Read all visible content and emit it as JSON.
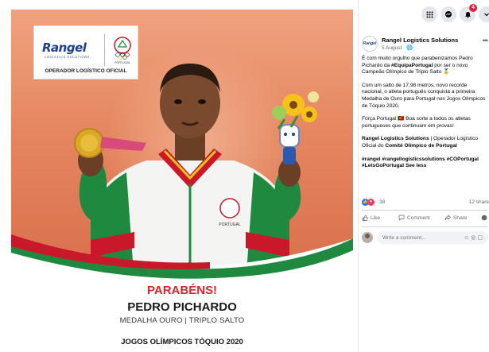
{
  "image": {
    "logo": {
      "brand": "Rangel",
      "brand_sub": "LOGISTICS SOLUTIONS",
      "partner": "PORTUGAL",
      "tagline": "OPERADOR LOGÍSTICO OFICIAL"
    },
    "caption": {
      "congrats": "PARABÉNS!",
      "athlete_name": "PEDRO PICHARDO",
      "medal": "MEDALHA OURO | TRIPLO SALTO",
      "games": "JOGOS OLÍMPICOS TÓQUIO 2020"
    }
  },
  "facebook": {
    "topbar": {
      "icons": [
        "menu-grid-icon",
        "messenger-icon",
        "notifications-icon",
        "account-dropdown-icon"
      ],
      "notification_count": "4"
    },
    "post": {
      "page_avatar_text": "Rangel",
      "page_name": "Rangel Logistics Solutions",
      "date": "5 August · ",
      "paragraph1_a": "É com muito orgulho que parabenizamos Pedro Pichardo da ",
      "paragraph1_tag": "#EquipaPortugal",
      "paragraph1_b": " por ser o novo Campeão Olímpico de Triplo Salto 🏅",
      "paragraph2": "Com um salto de 17,98 metros, novo recorde nacional, o atleta português conquista a primeira Medalha de Ouro para Portugal nos Jogos Olímpicos de Tóquio 2020.",
      "paragraph3": "Força Portugal 🇵🇹 Boa sorte a todos os atletas portugueses que continuam em provas!",
      "paragraph4_bold1": "Rangel Logistics Solutions",
      "paragraph4_mid": " | Operador Logístico Oficial do ",
      "paragraph4_bold2": "Comité Olímpico de Portugal",
      "hashtags": "#rangel #rangellogisticssolutions #COPortugal #LetsGoPortugal",
      "see_less": "See less"
    },
    "stats": {
      "reactions": "38",
      "shares": "12 share"
    },
    "actions": {
      "like": "Like",
      "comment": "Comment",
      "share": "Share"
    },
    "comment": {
      "placeholder": "Write a comment..."
    },
    "colors": {
      "accent": "#1877f2",
      "love": "#f33e58",
      "text": "#050505",
      "muted": "#65676b"
    }
  }
}
